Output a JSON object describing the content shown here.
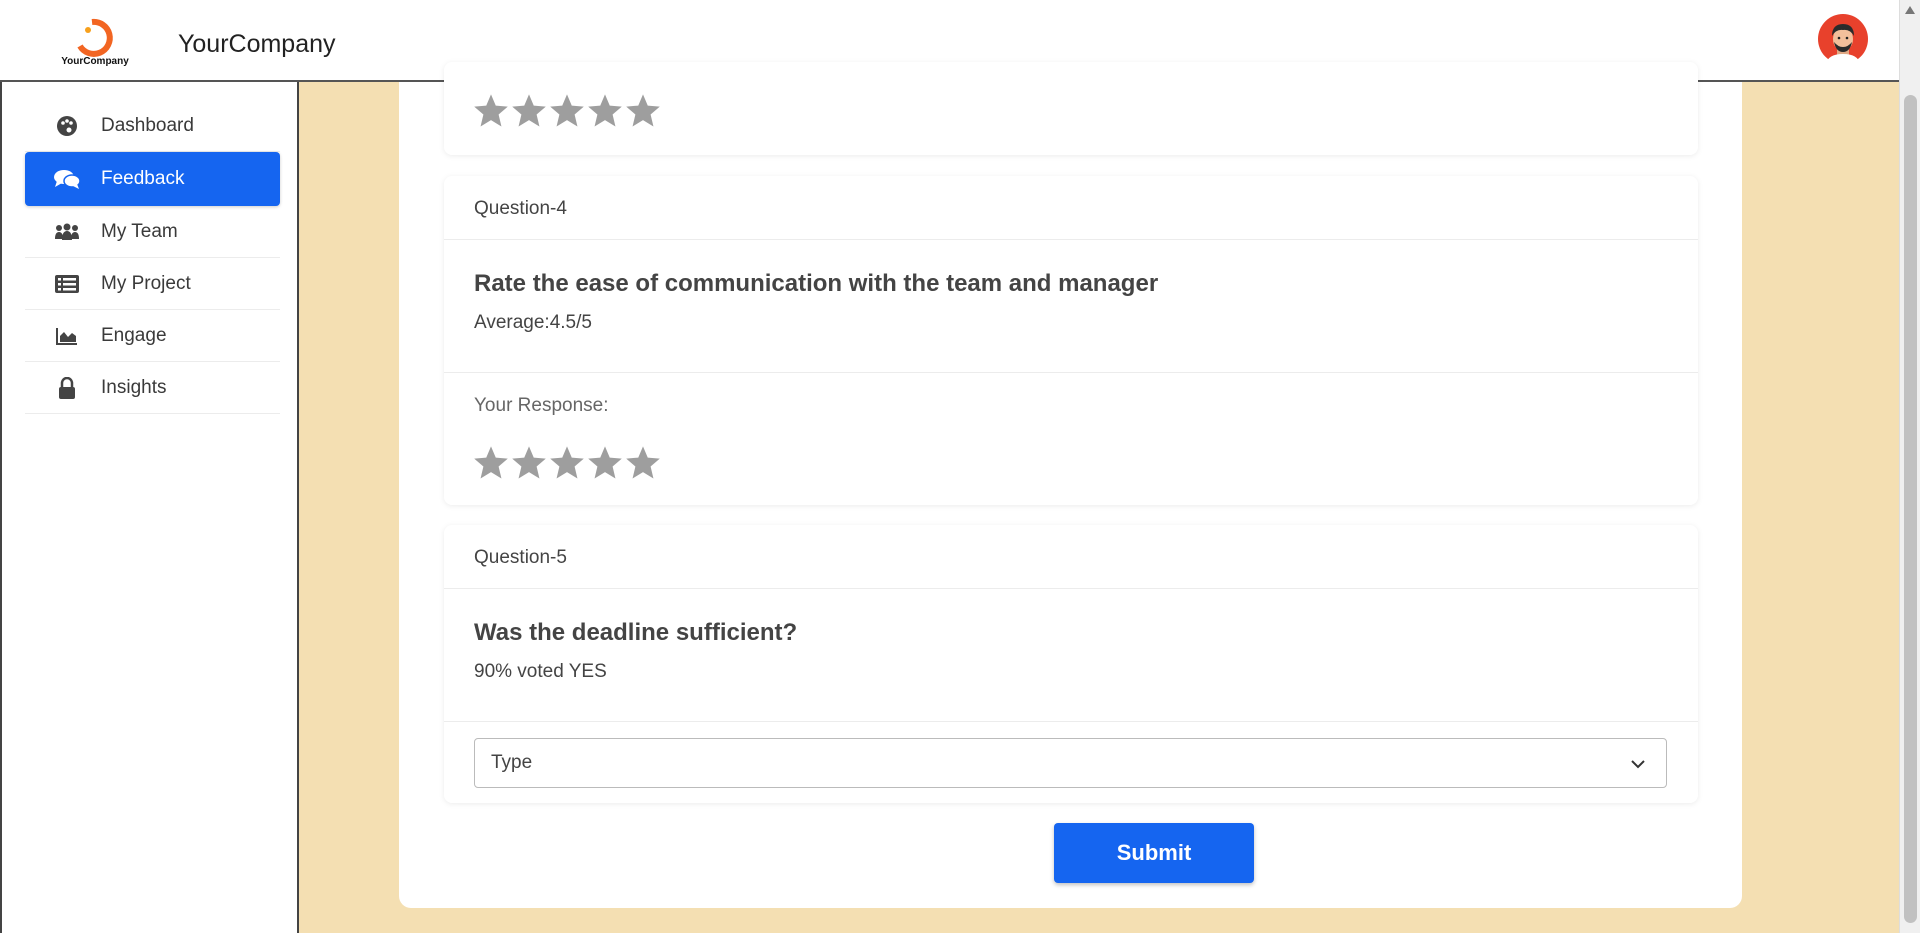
{
  "header": {
    "logo_text": "YourCompany",
    "brand": "YourCompany"
  },
  "sidebar": {
    "items": [
      {
        "label": "Dashboard",
        "icon": "palette-icon"
      },
      {
        "label": "Feedback",
        "icon": "comments-icon",
        "active": true
      },
      {
        "label": "My Team",
        "icon": "users-icon"
      },
      {
        "label": "My Project",
        "icon": "list-icon"
      },
      {
        "label": "Engage",
        "icon": "area-chart-icon"
      },
      {
        "label": "Insights",
        "icon": "lock-icon"
      }
    ]
  },
  "questions": [
    {
      "title": "Question-4",
      "text": "Rate the ease of communication with the team and manager",
      "stat": "Average:4.5/5",
      "response_label": "Your Response:",
      "rating": 0,
      "max_rating": 5
    },
    {
      "title": "Question-5",
      "text": "Was the deadline sufficient?",
      "stat": "90% voted YES",
      "select_value": "Type"
    }
  ],
  "previous_question": {
    "rating": 0,
    "max_rating": 5
  },
  "submit_label": "Submit",
  "colors": {
    "accent": "#1565f0",
    "background": "#f4dfb2",
    "star_empty": "#9e9e9e"
  }
}
